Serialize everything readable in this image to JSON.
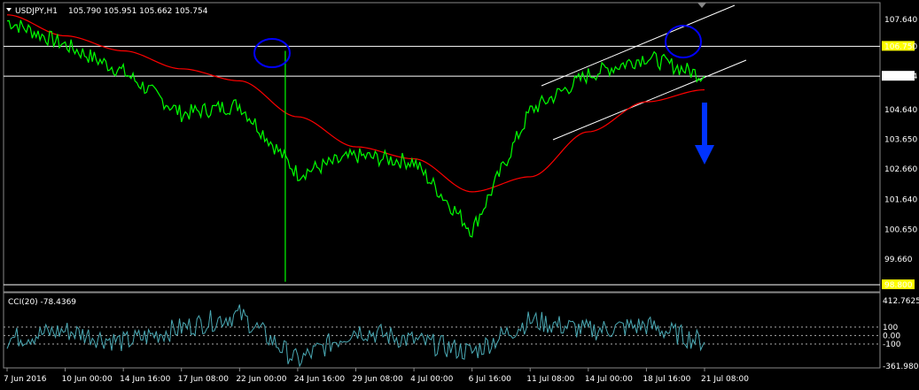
{
  "header": {
    "symbol": "USDJPY,H1",
    "quote": "105.790 105.951 105.662 105.754"
  },
  "indicator": {
    "label": "CCI(20) -78.4369",
    "axis_ticks": [
      "412.7625",
      "100",
      "0.00",
      "-100",
      "-361.9809"
    ],
    "levels": [
      100,
      -100
    ],
    "range": [
      -361.9809,
      412.7625
    ]
  },
  "colors": {
    "price_line": "#00ff00",
    "moving_average": "#ff0000",
    "cci_line": "#4aa9b4",
    "annotation_circle": "#0000ff",
    "arrow": "#0033ff",
    "channel": "#ffffff",
    "price_label_bg": "#ffff00"
  },
  "price_axis": {
    "ticks": [
      "107.640",
      "106.750",
      "105.754",
      "104.640",
      "103.650",
      "102.660",
      "101.640",
      "100.650",
      "99.660",
      "98.800"
    ],
    "horizontal_lines": [
      106.75,
      105.754,
      98.8
    ],
    "highlighted_labels": [
      "106.750",
      "98.800"
    ],
    "current_price_label": "105.754"
  },
  "time_axis": {
    "labels": [
      "7 Jun 2016",
      "10 Jun 00:00",
      "14 Jun 16:00",
      "17 Jun 08:00",
      "22 Jun 00:00",
      "24 Jun 16:00",
      "29 Jun 08:00",
      "4 Jul 00:00",
      "6 Jul 16:00",
      "11 Jul 08:00",
      "14 Jul 00:00",
      "18 Jul 16:00",
      "21 Jul 08:00"
    ]
  },
  "chart_data": {
    "type": "line",
    "title": "USDJPY,H1",
    "ylim": [
      98.8,
      108.0
    ],
    "x": [
      "7 Jun 2016",
      "10 Jun 00:00",
      "14 Jun 16:00",
      "17 Jun 08:00",
      "22 Jun 00:00",
      "24 Jun 16:00",
      "29 Jun 08:00",
      "4 Jul 00:00",
      "6 Jul 16:00",
      "11 Jul 08:00",
      "14 Jul 00:00",
      "18 Jul 16:00",
      "21 Jul 08:00"
    ],
    "series": [
      {
        "values": [
          107.6,
          106.8,
          105.9,
          104.5,
          104.8,
          102.5,
          103.1,
          102.9,
          100.6,
          104.6,
          105.8,
          106.4,
          105.754
        ]
      },
      {
        "values": [
          107.8,
          107.1,
          106.6,
          106.0,
          105.6,
          104.4,
          103.4,
          103.0,
          101.9,
          102.4,
          103.9,
          104.9,
          105.3
        ]
      }
    ],
    "cci": [
      -40,
      60,
      -80,
      90,
      250,
      -300,
      70,
      -60,
      -200,
      180,
      60,
      120,
      -78.4369
    ]
  }
}
